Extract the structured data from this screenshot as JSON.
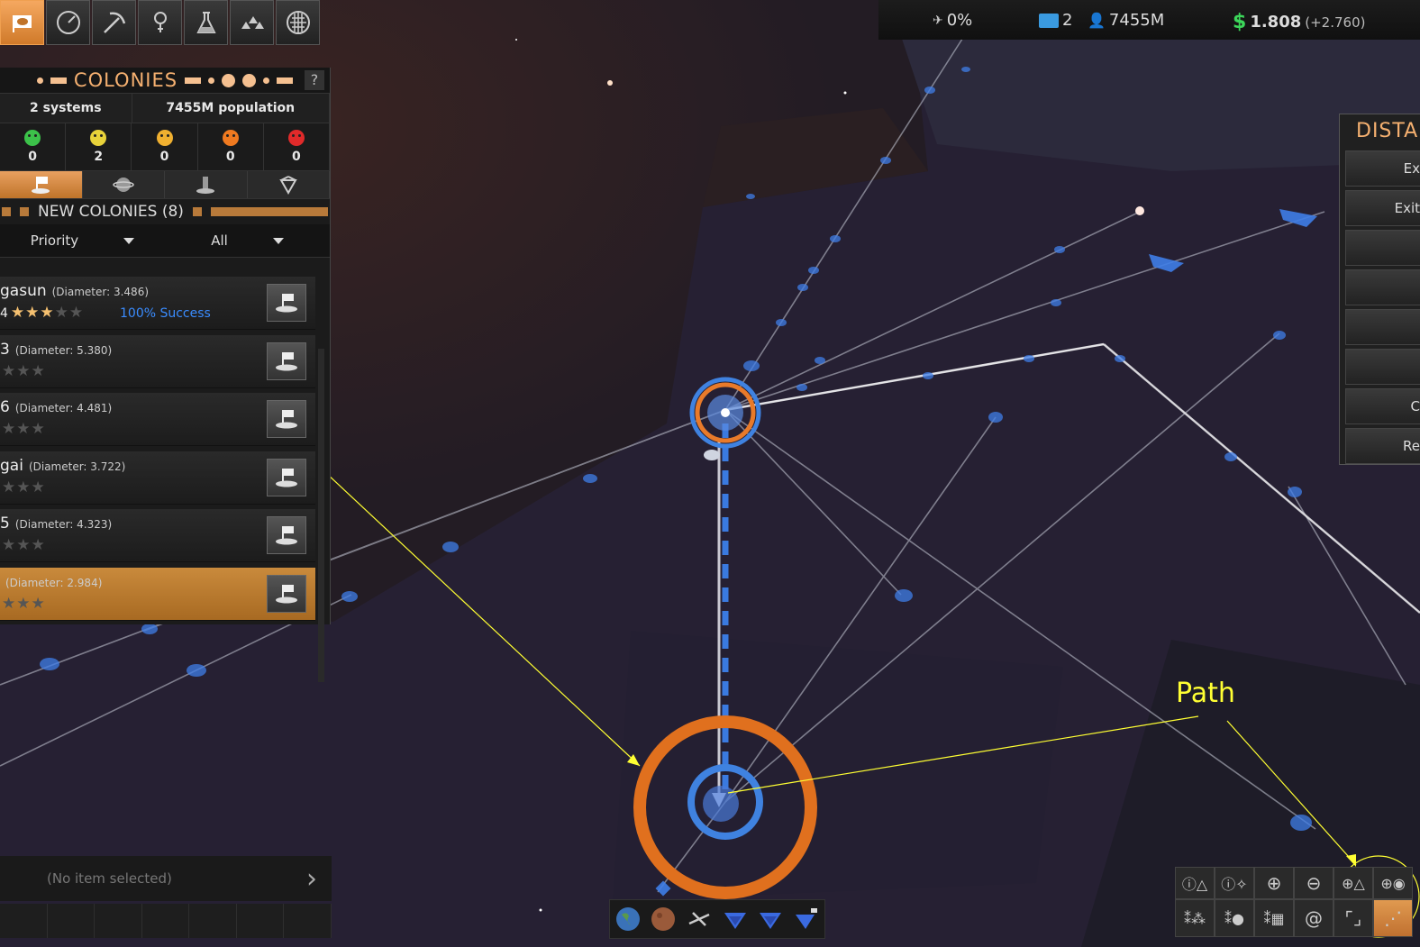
{
  "toolbar": {
    "buttons": [
      {
        "name": "colonies",
        "icon": "planet-flag-icon",
        "active": true
      },
      {
        "name": "policies",
        "icon": "dial-icon"
      },
      {
        "name": "resources",
        "icon": "pickaxe-icon"
      },
      {
        "name": "research-tracker",
        "icon": "bulb-icon"
      },
      {
        "name": "research",
        "icon": "flask-icon"
      },
      {
        "name": "fleets",
        "icon": "ships-icon"
      },
      {
        "name": "empire",
        "icon": "grid-globe-icon"
      }
    ]
  },
  "colonies_panel": {
    "title": "COLONIES",
    "help": "?",
    "systems": "2 systems",
    "population": "7455M population",
    "moods": [
      {
        "icon": "ecstatic-face-icon",
        "color": "#3cc24a",
        "count": "0"
      },
      {
        "icon": "happy-face-icon",
        "color": "#e8d23a",
        "count": "2"
      },
      {
        "icon": "content-face-icon",
        "color": "#f0b030",
        "count": "0"
      },
      {
        "icon": "unhappy-face-icon",
        "color": "#f07a20",
        "count": "0"
      },
      {
        "icon": "angry-face-icon",
        "color": "#e02a2a",
        "count": "0"
      }
    ],
    "subtabs": [
      "new-colony-icon",
      "planet-icon",
      "outpost-icon",
      "diamond-icon"
    ],
    "section_title": "NEW COLONIES (8)",
    "filter_priority": "Priority",
    "filter_all": "All",
    "rows": [
      {
        "name": "gasun",
        "diameter": "(Diameter: 3.486)",
        "prefix": "4",
        "stars_on": 3,
        "stars": 5,
        "success": "100% Success"
      },
      {
        "name": "3",
        "diameter": "(Diameter: 5.380)",
        "prefix": "",
        "stars_on": 0,
        "stars": 3,
        "success": ""
      },
      {
        "name": "6",
        "diameter": "(Diameter: 4.481)",
        "prefix": "",
        "stars_on": 0,
        "stars": 3,
        "success": ""
      },
      {
        "name": "gai",
        "diameter": "(Diameter: 3.722)",
        "prefix": "",
        "stars_on": 0,
        "stars": 3,
        "success": ""
      },
      {
        "name": "5",
        "diameter": "(Diameter: 4.323)",
        "prefix": "",
        "stars_on": 0,
        "stars": 3,
        "success": ""
      },
      {
        "name": "",
        "diameter": "(Diameter: 2.984)",
        "prefix": "",
        "stars_on": 0,
        "stars": 3,
        "success": "",
        "selected": true
      }
    ]
  },
  "topbar": {
    "influence": "0%",
    "systems_count": "2",
    "population": "7455M",
    "money": "1.808",
    "income": "(+2.760)"
  },
  "right_panel": {
    "title": "DISTA",
    "buttons": [
      "Ex",
      "Exit",
      "",
      "",
      "",
      "",
      "C",
      "Re"
    ]
  },
  "selection": {
    "text": "(No item selected)"
  },
  "bottom_center": {
    "icons": [
      "earth-icon",
      "mars-icon",
      "satellite-icon",
      "fleet-blue-icon",
      "fleet-blue2-icon",
      "ship-flag-icon"
    ]
  },
  "bottom_right": {
    "row1": [
      "filter-a-icon",
      "filter-b-icon",
      "zoom-in-icon",
      "zoom-out-icon",
      "zoom-fit-icon",
      "zoom-system-icon"
    ],
    "row2": [
      "show-grid-icon",
      "show-planets-icon",
      "show-stats-icon",
      "galaxy-icon",
      "recenter-icon",
      "path-icon"
    ]
  },
  "annotation": {
    "label": "Path",
    "color": "#ffff33"
  }
}
